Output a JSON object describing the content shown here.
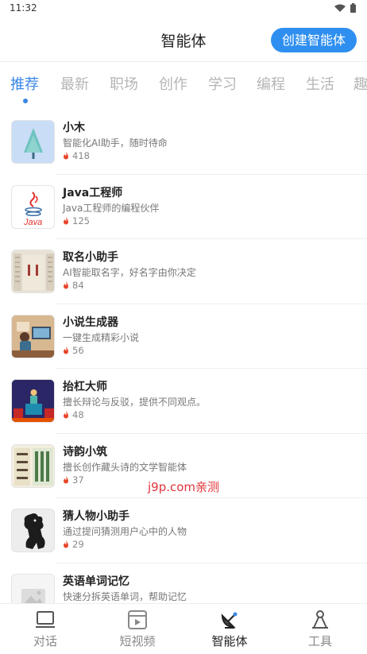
{
  "status": {
    "time": "11:32"
  },
  "header": {
    "title": "智能体",
    "create_label": "创建智能体"
  },
  "tabs": [
    "推荐",
    "最新",
    "职场",
    "创作",
    "学习",
    "编程",
    "生活",
    "趣"
  ],
  "agents": [
    {
      "name": "小木",
      "desc": "智能化AI助手，随时待命",
      "count": "418",
      "icon": "tree-icon"
    },
    {
      "name": "Java工程师",
      "desc": "Java工程师的编程伙伴",
      "count": "125",
      "icon": "java-logo-icon"
    },
    {
      "name": "取名小助手",
      "desc": "AI智能取名字，好名字由你决定",
      "count": "84",
      "icon": "naming-poster-icon"
    },
    {
      "name": "小说生成器",
      "desc": "一键生成精彩小说",
      "count": "56",
      "icon": "writer-desk-icon"
    },
    {
      "name": "抬杠大师",
      "desc": "擅长辩论与反驳，提供不同观点。",
      "count": "48",
      "icon": "debate-stage-icon"
    },
    {
      "name": "诗韵小筑",
      "desc": "擅长创作藏头诗的文学智能体",
      "count": "37",
      "icon": "poetry-icon"
    },
    {
      "name": "猜人物小助手",
      "desc": "通过提问猜测用户心中的人物",
      "count": "29",
      "icon": "silhouette-icon"
    },
    {
      "name": "英语单词记忆",
      "desc": "快速分拆英语单词，帮助记忆",
      "count": "",
      "icon": "image-placeholder-icon"
    }
  ],
  "watermark": "j9p.com亲测",
  "nav": [
    "对话",
    "短视频",
    "智能体",
    "工具"
  ],
  "colors": {
    "accent": "#2f8ff0",
    "tab_active": "#3a86e6",
    "flame": "#e8452b"
  }
}
